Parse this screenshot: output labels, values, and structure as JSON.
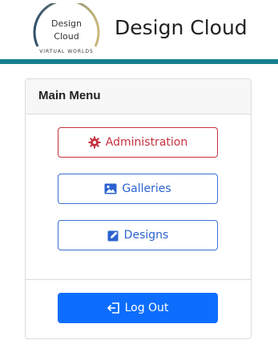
{
  "header": {
    "logo": {
      "line1": "Design",
      "line2": "Cloud",
      "tagline": "VIRTUAL WORLDS"
    },
    "title": "Design Cloud",
    "accent_color": "#18808e"
  },
  "menu": {
    "title": "Main Menu",
    "items": [
      {
        "label": "Administration",
        "icon": "gear-icon",
        "color": "#c5313e"
      },
      {
        "label": "Galleries",
        "icon": "image-icon",
        "color": "#2a63cf"
      },
      {
        "label": "Designs",
        "icon": "edit-icon",
        "color": "#2a63cf"
      }
    ],
    "logout": {
      "label": "Log Out",
      "icon": "sign-out-icon",
      "color": "#0d6efd"
    }
  }
}
